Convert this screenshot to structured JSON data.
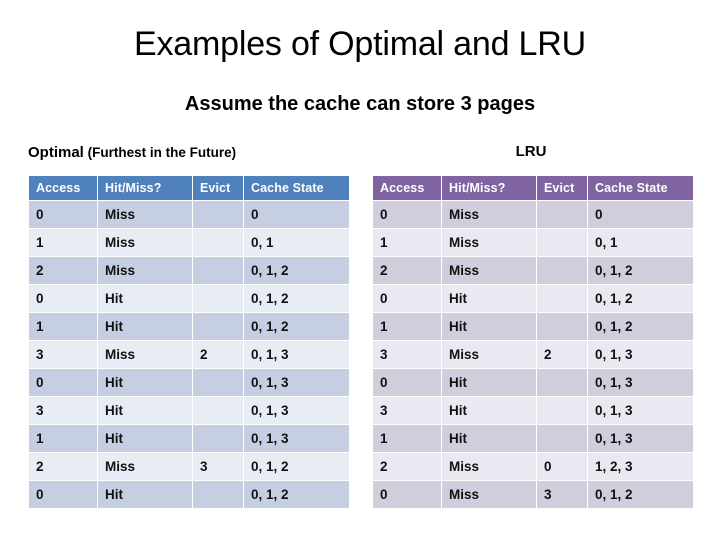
{
  "slide": {
    "title": "Examples of Optimal and LRU",
    "subtitle": "Assume the cache can store 3 pages"
  },
  "colors": {
    "optimal_header": "#4f81bd",
    "optimal_row_odd": "#c6cfe1",
    "optimal_row_even": "#e8ecf4",
    "lru_header": "#8064a2",
    "lru_row_odd": "#d2cddd",
    "lru_row_even": "#ebe8f1",
    "background": "#ffffff",
    "text": "#000000"
  },
  "tables": {
    "optimal": {
      "caption_main": "Optimal",
      "caption_sub": "(Furthest in the Future)",
      "caption_full": "Optimal (Furthest in the Future)",
      "columns": [
        "Access",
        "Hit/Miss?",
        "Evict",
        "Cache State"
      ],
      "rows": [
        {
          "access": "0",
          "hit_miss": "Miss",
          "evict": "",
          "cache_state": "0"
        },
        {
          "access": "1",
          "hit_miss": "Miss",
          "evict": "",
          "cache_state": "0, 1"
        },
        {
          "access": "2",
          "hit_miss": "Miss",
          "evict": "",
          "cache_state": "0, 1, 2"
        },
        {
          "access": "0",
          "hit_miss": "Hit",
          "evict": "",
          "cache_state": "0, 1, 2"
        },
        {
          "access": "1",
          "hit_miss": "Hit",
          "evict": "",
          "cache_state": "0, 1, 2"
        },
        {
          "access": "3",
          "hit_miss": "Miss",
          "evict": "2",
          "cache_state": "0, 1, 3"
        },
        {
          "access": "0",
          "hit_miss": "Hit",
          "evict": "",
          "cache_state": "0, 1, 3"
        },
        {
          "access": "3",
          "hit_miss": "Hit",
          "evict": "",
          "cache_state": "0, 1, 3"
        },
        {
          "access": "1",
          "hit_miss": "Hit",
          "evict": "",
          "cache_state": "0, 1, 3"
        },
        {
          "access": "2",
          "hit_miss": "Miss",
          "evict": "3",
          "cache_state": "0, 1, 2"
        },
        {
          "access": "0",
          "hit_miss": "Hit",
          "evict": "",
          "cache_state": "0, 1, 2"
        }
      ]
    },
    "lru": {
      "caption_main": "LRU",
      "columns": [
        "Access",
        "Hit/Miss?",
        "Evict",
        "Cache State"
      ],
      "rows": [
        {
          "access": "0",
          "hit_miss": "Miss",
          "evict": "",
          "cache_state": "0"
        },
        {
          "access": "1",
          "hit_miss": "Miss",
          "evict": "",
          "cache_state": "0, 1"
        },
        {
          "access": "2",
          "hit_miss": "Miss",
          "evict": "",
          "cache_state": "0, 1, 2"
        },
        {
          "access": "0",
          "hit_miss": "Hit",
          "evict": "",
          "cache_state": "0, 1, 2"
        },
        {
          "access": "1",
          "hit_miss": "Hit",
          "evict": "",
          "cache_state": "0, 1, 2"
        },
        {
          "access": "3",
          "hit_miss": "Miss",
          "evict": "2",
          "cache_state": "0, 1, 3"
        },
        {
          "access": "0",
          "hit_miss": "Hit",
          "evict": "",
          "cache_state": "0, 1, 3"
        },
        {
          "access": "3",
          "hit_miss": "Hit",
          "evict": "",
          "cache_state": "0, 1, 3"
        },
        {
          "access": "1",
          "hit_miss": "Hit",
          "evict": "",
          "cache_state": "0, 1, 3"
        },
        {
          "access": "2",
          "hit_miss": "Miss",
          "evict": "0",
          "cache_state": "1, 2, 3"
        },
        {
          "access": "0",
          "hit_miss": "Miss",
          "evict": "3",
          "cache_state": "0, 1, 2"
        }
      ]
    }
  }
}
